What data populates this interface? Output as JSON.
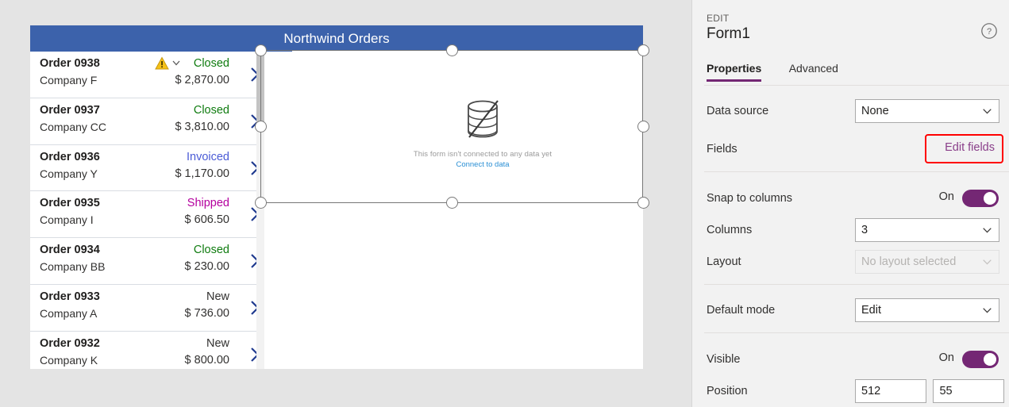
{
  "canvas": {
    "screen_header_title": "Northwind Orders",
    "gallery": {
      "items": [
        {
          "title": "Order 0938",
          "company": "Company F",
          "status": "Closed",
          "status_color": "#107c10",
          "amount": "$ 2,870.00",
          "has_warning": true
        },
        {
          "title": "Order 0937",
          "company": "Company CC",
          "status": "Closed",
          "status_color": "#107c10",
          "amount": "$ 3,810.00",
          "has_warning": false
        },
        {
          "title": "Order 0936",
          "company": "Company Y",
          "status": "Invoiced",
          "status_color": "#4a5bd6",
          "amount": "$ 1,170.00",
          "has_warning": false
        },
        {
          "title": "Order 0935",
          "company": "Company I",
          "status": "Shipped",
          "status_color": "#b4009e",
          "amount": "$ 606.50",
          "has_warning": false
        },
        {
          "title": "Order 0934",
          "company": "Company BB",
          "status": "Closed",
          "status_color": "#107c10",
          "amount": "$ 230.00",
          "has_warning": false
        },
        {
          "title": "Order 0933",
          "company": "Company A",
          "status": "New",
          "status_color": "#323130",
          "amount": "$ 736.00",
          "has_warning": false
        },
        {
          "title": "Order 0932",
          "company": "Company K",
          "status": "New",
          "status_color": "#323130",
          "amount": "$ 800.00",
          "has_warning": false
        }
      ]
    },
    "form": {
      "empty_text": "This form isn't connected to any data yet",
      "connect_link": "Connect to data"
    }
  },
  "pane": {
    "eyebrow": "EDIT",
    "title": "Form1",
    "help_icon": "question-circle-icon",
    "tabs": [
      {
        "label": "Properties",
        "active": true
      },
      {
        "label": "Advanced",
        "active": false
      }
    ],
    "properties": {
      "data_source_label": "Data source",
      "data_source_value": "None",
      "fields_label": "Fields",
      "edit_fields_label": "Edit fields",
      "snap_label": "Snap to columns",
      "snap_state": "On",
      "columns_label": "Columns",
      "columns_value": "3",
      "layout_label": "Layout",
      "layout_value": "No layout selected",
      "default_mode_label": "Default mode",
      "default_mode_value": "Edit",
      "visible_label": "Visible",
      "visible_state": "On",
      "position_label": "Position",
      "position_x": "512",
      "position_y": "55"
    }
  },
  "colors": {
    "header_blue": "#3c62ab",
    "accent_purple": "#742774",
    "link_purple": "#8a3f8a",
    "annotation_red": "#ff0000",
    "chevron_blue": "#1f3a8f"
  }
}
